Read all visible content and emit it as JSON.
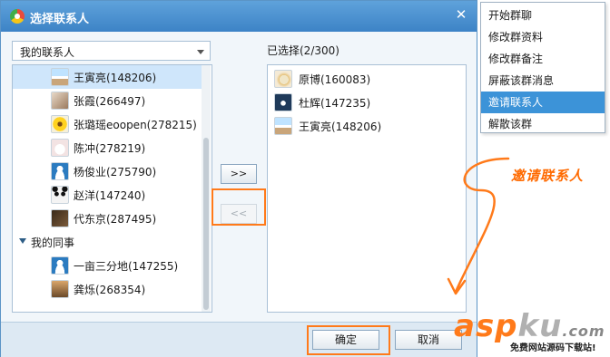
{
  "dialog": {
    "title": "选择联系人",
    "close_glyph": "✕",
    "group_select": {
      "value": "我的联系人"
    },
    "contacts": [
      {
        "name": "王寅亮(148206)",
        "avatar": "avatar-ocean",
        "selected": true
      },
      {
        "name": "张霞(266497)",
        "avatar": "avatar-person"
      },
      {
        "name": "张璐瑶eoopen(278215)",
        "avatar": "avatar-flower"
      },
      {
        "name": "陈冲(278219)",
        "avatar": "avatar-bunny"
      },
      {
        "name": "杨俊业(275790)",
        "avatar": "avatar-default"
      },
      {
        "name": "赵洋(147240)",
        "avatar": "avatar-panda"
      },
      {
        "name": "代东京(287495)",
        "avatar": "avatar-dark"
      }
    ],
    "group2": {
      "name": "我的同事"
    },
    "group2_contacts": [
      {
        "name": "一亩三分地(147255)",
        "avatar": "avatar-default"
      },
      {
        "name": "龚烁(268354)",
        "avatar": "avatar-landscape"
      }
    ],
    "add_button": ">>",
    "remove_button": "<<",
    "selected_count": "已选择(2/300)",
    "selected": [
      {
        "name": "原博(160083)",
        "avatar": "avatar-cartoon"
      },
      {
        "name": "杜辉(147235)",
        "avatar": "avatar-heart"
      },
      {
        "name": "王寅亮(148206)",
        "avatar": "avatar-ocean"
      }
    ],
    "ok_button": "确定",
    "cancel_button": "取消"
  },
  "context_menu": {
    "items": [
      {
        "label": "开始群聊"
      },
      {
        "label": "修改群资料"
      },
      {
        "label": "修改群备注"
      },
      {
        "label": "屏蔽该群消息"
      },
      {
        "label": "邀请联系人",
        "active": true
      },
      {
        "label": "解散该群"
      }
    ]
  },
  "annotation": {
    "text": "邀请联系人"
  },
  "watermark": {
    "logo_a": "asp",
    "logo_b": "ku",
    "logo_c": ".com",
    "tagline": "免费网站源码下载站!"
  },
  "colors": {
    "accent": "#3c93d8",
    "highlight_frame": "#ff7a1a",
    "titlebar": "#4a90d0"
  }
}
